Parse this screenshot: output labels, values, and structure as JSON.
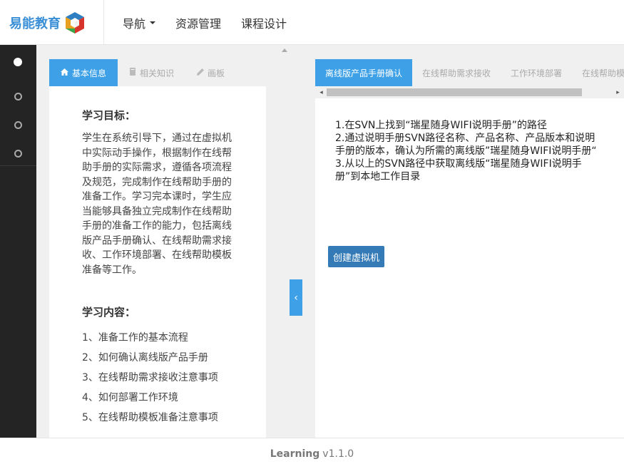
{
  "brand": {
    "name": "易能教育",
    "logo_icon": "cube-logo-icon"
  },
  "nav": {
    "items": [
      {
        "label": "导航",
        "dropdown": true
      },
      {
        "label": "资源管理",
        "dropdown": false
      },
      {
        "label": "课程设计",
        "dropdown": false
      }
    ]
  },
  "left_tabs": [
    {
      "label": "基本信息",
      "icon": "home-icon",
      "active": true
    },
    {
      "label": "相关知识",
      "icon": "book-icon",
      "active": false
    },
    {
      "label": "画板",
      "icon": "pencil-icon",
      "active": false
    }
  ],
  "learning": {
    "goal_title": "学习目标：",
    "goal_text": "学生在系统引导下，通过在虚拟机中实际动手操作，根据制作在线帮助手册的实际需求，遵循各项流程及规范，完成制作在线帮助手册的准备工作。学习完本课时，学生应当能够具备独立完成制作在线帮助手册的准备工作的能力，包括离线版产品手册确认、在线帮助需求接收、工作环境部署、在线帮助模板准备等工作。",
    "content_title": "学习内容：",
    "content_items": [
      "1、准备工作的基本流程",
      "2、如何确认离线版产品手册",
      "3、在线帮助需求接收注意事项",
      "4、如何部署工作环境",
      "5、在线帮助模板准备注意事项"
    ]
  },
  "right_tabs": [
    {
      "label": "离线版产品手册确认",
      "active": true
    },
    {
      "label": "在线帮助需求接收",
      "active": false
    },
    {
      "label": "工作环境部署",
      "active": false
    },
    {
      "label": "在线帮助模板",
      "active": false
    }
  ],
  "task": {
    "steps": [
      "1.在SVN上找到“瑞星随身WIFI说明手册”的路径",
      "2.通过说明手册SVN路径名称、产品名称、产品版本和说明手册的版本，确认为所需的离线版”瑞星随身WIFI说明手册“",
      "3.从以上的SVN路径中获取离线版“瑞星随身WIFI说明手册”到本地工作目录"
    ],
    "create_button": "创建虚拟机"
  },
  "splitter": {
    "collapse_glyph": "‹"
  },
  "footer": {
    "name": "Learning",
    "version": "v1.1.0"
  },
  "colors": {
    "accent": "#3ea0e6",
    "button": "#337ab7",
    "sidebar": "#242424",
    "brand": "#3a8fd6"
  }
}
